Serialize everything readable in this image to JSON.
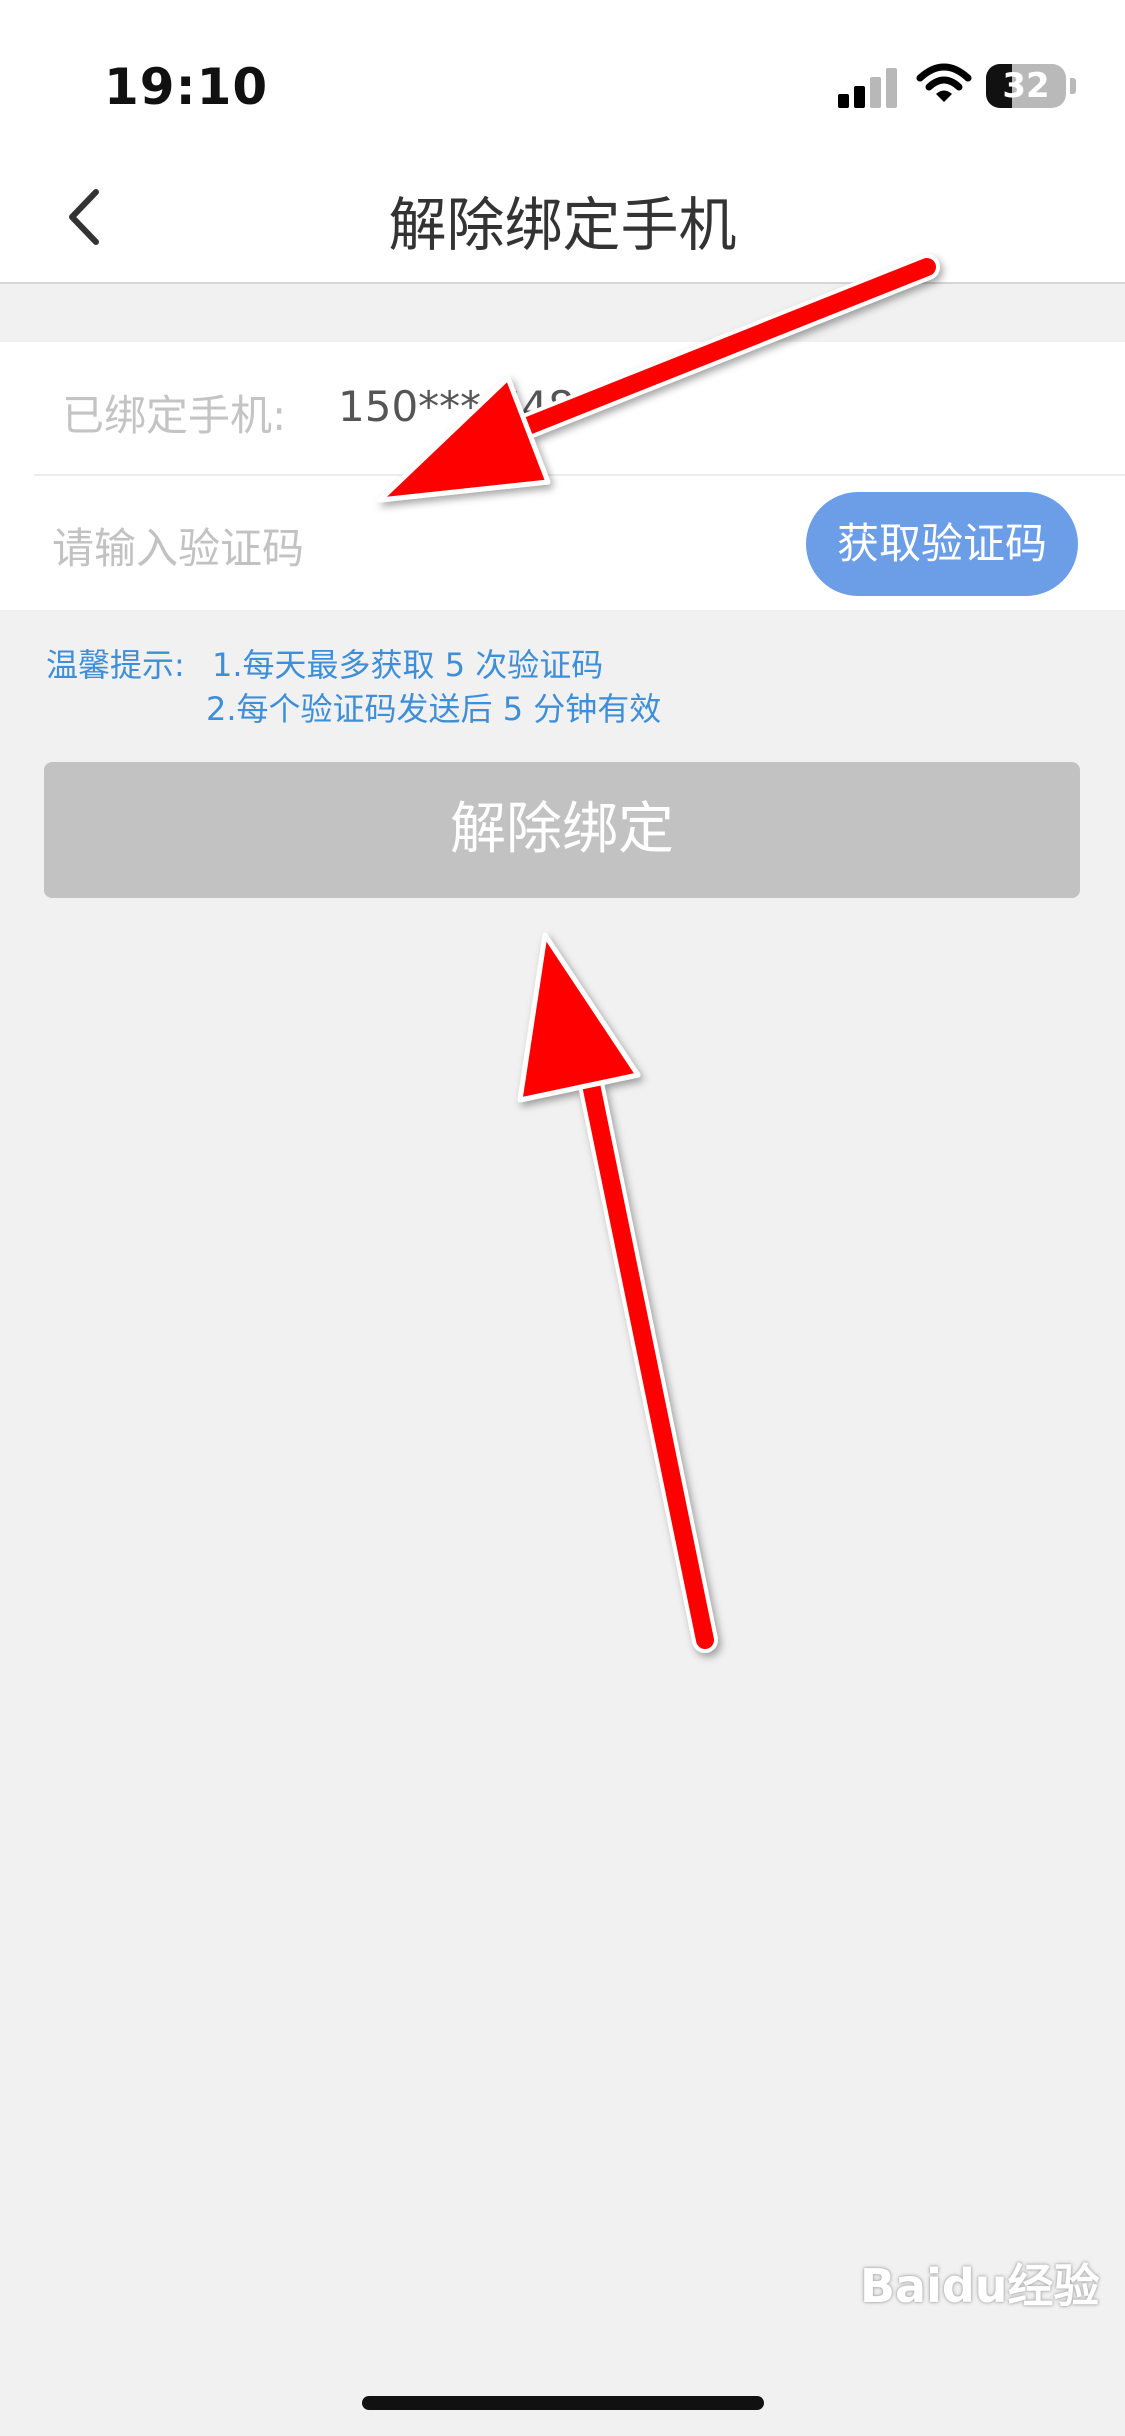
{
  "status_bar": {
    "time": "19:10",
    "battery": "32"
  },
  "nav": {
    "title": "解除绑定手机",
    "back_icon": "chevron-left-icon"
  },
  "form": {
    "bound_label": "已绑定手机:",
    "bound_phone": "150*** 648",
    "code_placeholder": "请输入验证码",
    "get_code_label": "获取验证码"
  },
  "tips": {
    "label": "温馨提示:",
    "line1": "1.每天最多获取 5 次验证码",
    "line2": "2.每个验证码发送后 5 分钟有效"
  },
  "unbind_button_label": "解除绑定",
  "watermark": "Baidu经验",
  "colors": {
    "accent_blue": "#6b9ee6",
    "tip_blue": "#3f8ed8",
    "disabled_gray": "#c2c2c2",
    "annotation_red": "#ff0000"
  }
}
